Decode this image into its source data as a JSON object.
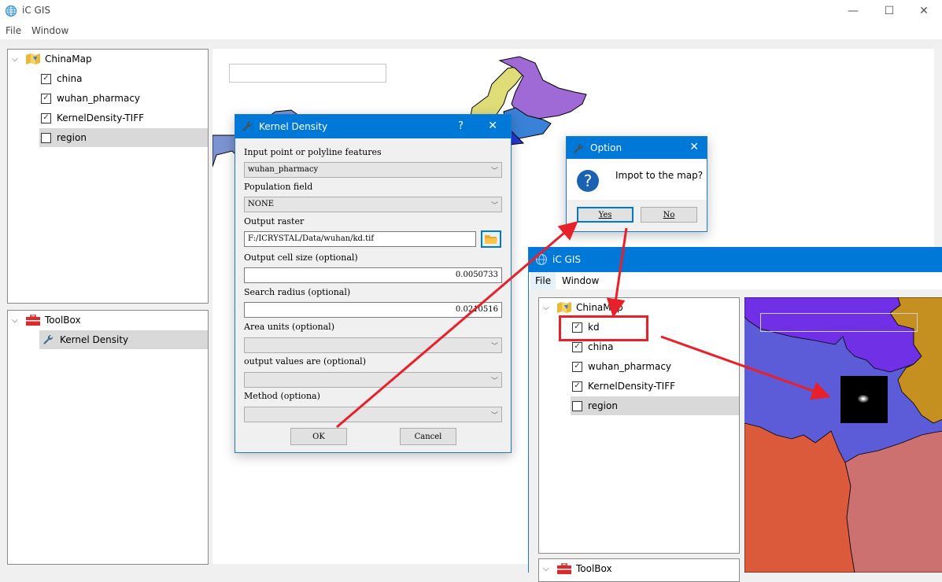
{
  "main_window": {
    "title": "iC GIS",
    "menu": [
      "File",
      "Window"
    ],
    "controls": {
      "minimize": "—",
      "maximize": "☐",
      "close": "✕"
    },
    "layers_tree": {
      "root": "ChinaMap",
      "items": [
        {
          "label": "china",
          "checked": true
        },
        {
          "label": "wuhan_pharmacy",
          "checked": true
        },
        {
          "label": "KernelDensity-TIFF",
          "checked": true
        },
        {
          "label": "region",
          "checked": false,
          "selected": true
        }
      ]
    },
    "toolbox_tree": {
      "root": "ToolBox",
      "items": [
        {
          "label": "Kernel Density",
          "selected": true
        }
      ]
    }
  },
  "kernel_dialog": {
    "title": "Kernel Density",
    "help": "?",
    "close": "✕",
    "fields": {
      "input_label": "Input point or polyline features",
      "input_value": "wuhan_pharmacy",
      "population_label": "Population field",
      "population_value": "NONE",
      "output_raster_label": "Output raster",
      "output_raster_value": "F:/ICRYSTAL/Data/wuhan/kd.tif",
      "cell_size_label": "Output cell size (optional)",
      "cell_size_value": "0.0050733",
      "search_radius_label": "Search radius (optional)",
      "search_radius_value": "0.0210516",
      "area_units_label": "Area units (optional)",
      "area_units_value": "",
      "output_values_label": "output values are (optional)",
      "output_values_value": "",
      "method_label": "Method (optiona)",
      "method_value": ""
    },
    "ok_label": "OK",
    "cancel_label": "Cancel"
  },
  "option_dialog": {
    "title": "Option",
    "close": "✕",
    "message": "Impot to the map?",
    "yes_label": "Yes",
    "no_label": "No"
  },
  "second_window": {
    "title": "iC GIS",
    "menu": [
      "File",
      "Window"
    ],
    "layers_tree": {
      "root": "ChinaMap",
      "items": [
        {
          "label": "kd",
          "checked": true,
          "highlighted": true
        },
        {
          "label": "china",
          "checked": true
        },
        {
          "label": "wuhan_pharmacy",
          "checked": true
        },
        {
          "label": "KernelDensity-TIFF",
          "checked": true
        },
        {
          "label": "region",
          "checked": false,
          "selected": true
        }
      ]
    },
    "toolbox_root": "ToolBox"
  },
  "colors": {
    "accent": "#0078d7",
    "annotation_red": "#e8202a",
    "selected_row": "#d9d9d9"
  }
}
